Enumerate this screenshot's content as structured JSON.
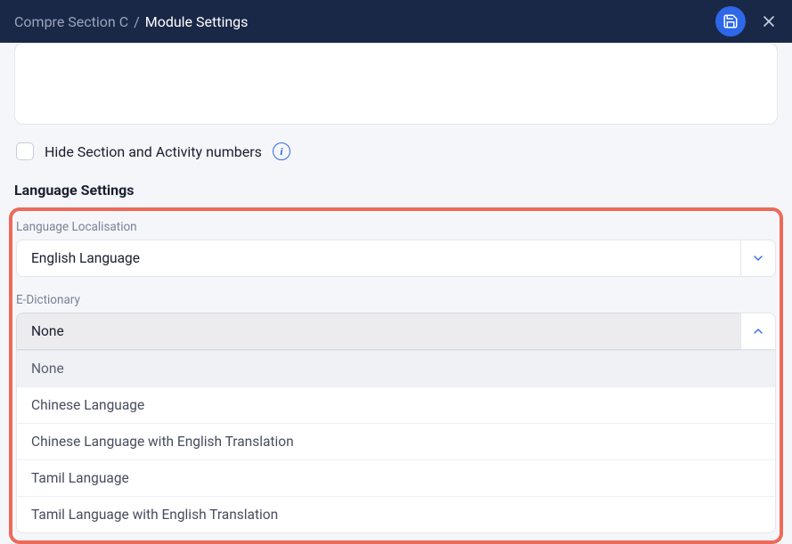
{
  "header": {
    "breadcrumb_parent": "Compre Section C",
    "breadcrumb_current": "Module Settings"
  },
  "hide_section": {
    "label": "Hide Section and Activity numbers"
  },
  "language_settings": {
    "heading": "Language Settings",
    "localisation_label": "Language Localisation",
    "localisation_value": "English Language",
    "edictionary_label": "E-Dictionary",
    "edictionary_value": "None",
    "edictionary_options": [
      "None",
      "Chinese Language",
      "Chinese Language with English Translation",
      "Tamil Language",
      "Tamil Language with English Translation"
    ]
  }
}
